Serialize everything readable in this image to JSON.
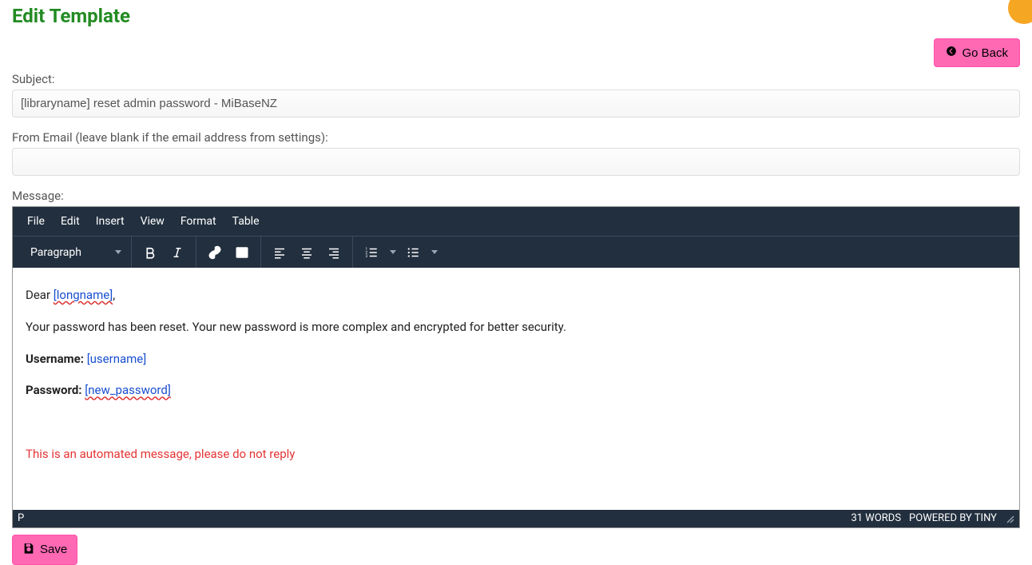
{
  "page": {
    "title": "Edit Template",
    "go_back_label": "Go Back"
  },
  "form": {
    "subject_label": "Subject:",
    "subject_value": "[libraryname] reset admin password - MiBaseNZ",
    "from_email_label": "From Email (leave blank if the email address from settings):",
    "from_email_value": "",
    "message_label": "Message:",
    "save_label": "Save"
  },
  "editor": {
    "menu": {
      "file": "File",
      "edit": "Edit",
      "insert": "Insert",
      "view": "View",
      "format": "Format",
      "table": "Table"
    },
    "toolbar": {
      "format_select": "Paragraph"
    },
    "content": {
      "greeting_prefix": "Dear ",
      "greeting_token": "[longname]",
      "greeting_suffix": ",",
      "line2": "Your password has been reset. Your new password is more complex and encrypted for better security.",
      "username_label": "Username:",
      "username_value": "[username]",
      "password_label": "Password:",
      "password_value": "[new_password]",
      "disclaimer": "This is an automated message, please do not reply"
    },
    "statusbar": {
      "path": "P",
      "word_count": "31 WORDS",
      "powered": "POWERED BY TINY"
    }
  }
}
